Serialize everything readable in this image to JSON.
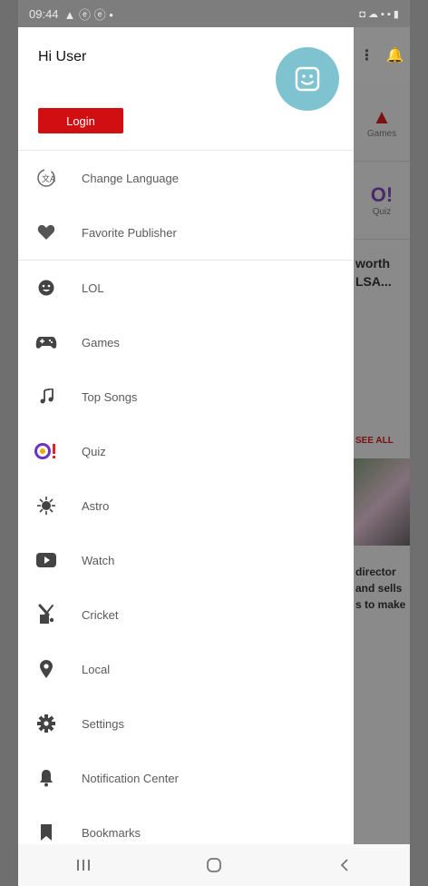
{
  "status_bar": {
    "time": "09:44",
    "left_icons": "▲ ⓔ ⓔ •",
    "right_icons": "◘ ☁ ▪ ▪ ▮"
  },
  "drawer": {
    "greeting": "Hi User",
    "login_label": "Login",
    "menu_top": [
      {
        "label": "Change Language",
        "icon": "language-icon"
      },
      {
        "label": "Favorite Publisher",
        "icon": "heart-icon"
      }
    ],
    "menu_main": [
      {
        "label": "LOL",
        "icon": "smiley-icon"
      },
      {
        "label": "Games",
        "icon": "gamepad-icon"
      },
      {
        "label": "Top Songs",
        "icon": "music-icon"
      },
      {
        "label": "Quiz",
        "icon": "quiz-icon"
      },
      {
        "label": "Astro",
        "icon": "astro-icon"
      },
      {
        "label": "Watch",
        "icon": "play-icon"
      },
      {
        "label": "Cricket",
        "icon": "cricket-icon"
      },
      {
        "label": "Local",
        "icon": "location-pin-icon"
      },
      {
        "label": "Settings",
        "icon": "gear-icon"
      },
      {
        "label": "Notification Center",
        "icon": "bell-icon"
      },
      {
        "label": "Bookmarks",
        "icon": "bookmark-icon"
      }
    ]
  },
  "background": {
    "games_label": "Games",
    "quiz_label": "Quiz",
    "headline": "worth LSA...",
    "see_all": "SEE ALL",
    "body_text": "director and sells s to make"
  },
  "colors": {
    "brand_red": "#d10f12",
    "avatar": "#7ec3cf",
    "quiz_purple": "#6a33c8"
  }
}
